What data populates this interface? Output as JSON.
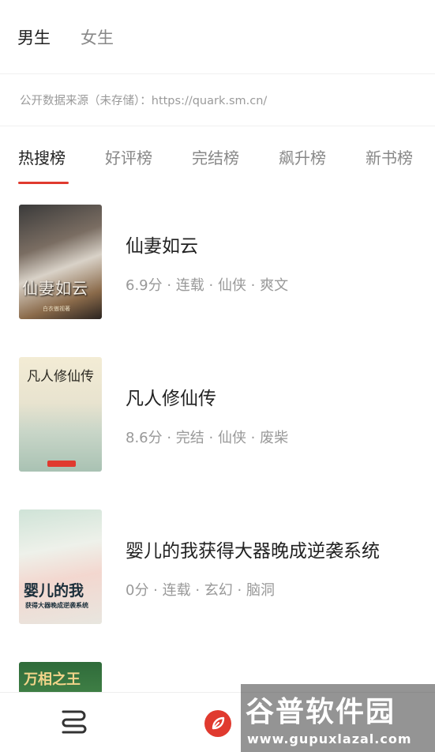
{
  "gender_tabs": [
    {
      "label": "男生",
      "active": true
    },
    {
      "label": "女生",
      "active": false
    }
  ],
  "source_notice": "公开数据来源（未存储）：https://quark.sm.cn/",
  "rank_tabs": [
    {
      "label": "热搜榜",
      "active": true
    },
    {
      "label": "好评榜",
      "active": false
    },
    {
      "label": "完结榜",
      "active": false
    },
    {
      "label": "飙升榜",
      "active": false
    },
    {
      "label": "新书榜",
      "active": false
    }
  ],
  "books": [
    {
      "title": "仙妻如云",
      "meta": "6.9分 · 连载 · 仙侠 · 爽文",
      "cover_text": "仙妻如云",
      "cover_sub": "白衣傲视著"
    },
    {
      "title": "凡人修仙传",
      "meta": "8.6分 · 完结 · 仙侠 · 废柴",
      "cover_text": "凡人修仙传"
    },
    {
      "title": "婴儿的我获得大器晚成逆袭系统",
      "meta": "0分 · 连载 · 玄幻 · 脑洞",
      "cover_text": "婴儿的我",
      "cover_sub": "获得大器晚成逆袭系统"
    },
    {
      "title": "",
      "meta": "",
      "cover_text": "万相之王"
    }
  ],
  "bottom_bar": {
    "icons": [
      "stack-icon",
      "discover-icon"
    ]
  },
  "watermark": {
    "text": "谷普软件园",
    "url": "www.gupuxlazal.com"
  },
  "colors": {
    "accent": "#e03a2f",
    "text_primary": "#222222",
    "text_secondary": "#999999"
  }
}
